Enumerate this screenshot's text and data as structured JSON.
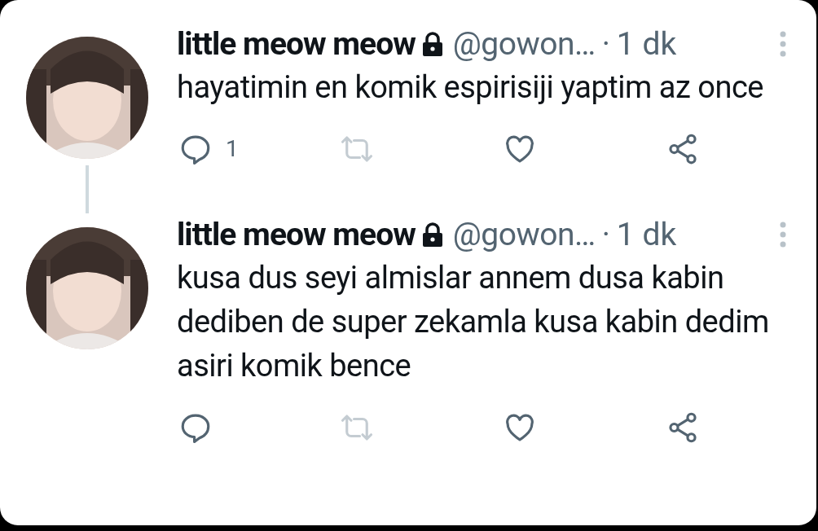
{
  "tweets": [
    {
      "name": "little meow meow",
      "protected": true,
      "handle": "@gowon…",
      "separator": "·",
      "time": "1 dk",
      "text": "hayatimin en komik espirisiji yaptim az once",
      "thread_continues": true,
      "actions": [
        {
          "kind": "reply",
          "count": "1",
          "disabled": false
        },
        {
          "kind": "retweet",
          "disabled": true
        },
        {
          "kind": "like",
          "disabled": false
        },
        {
          "kind": "share",
          "disabled": false
        }
      ]
    },
    {
      "name": "little meow meow",
      "protected": true,
      "handle": "@gowon…",
      "separator": "·",
      "time": "1 dk",
      "text": "kusa dus seyi almislar annem dusa kabin dediben de super zekamla kusa kabin dedim asiri komik bence",
      "thread_continues": false,
      "actions": [
        {
          "kind": "reply",
          "disabled": false
        },
        {
          "kind": "retweet",
          "disabled": true
        },
        {
          "kind": "like",
          "disabled": false
        },
        {
          "kind": "share",
          "disabled": false
        }
      ]
    }
  ]
}
